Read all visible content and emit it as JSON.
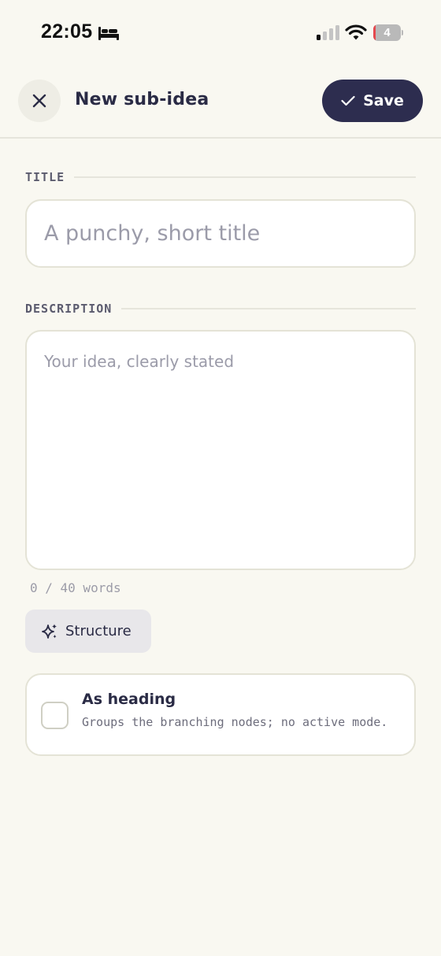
{
  "status_bar": {
    "time": "22:05",
    "battery_level": "4",
    "battery_fraction": 0.04,
    "icons": [
      "bed-icon",
      "cellular-signal-icon",
      "wifi-icon",
      "battery-icon"
    ]
  },
  "header": {
    "title": "New sub-idea",
    "close_icon": "close-icon",
    "save_label": "Save",
    "save_icon": "checkmark-icon"
  },
  "form": {
    "title_label": "TITLE",
    "title_value": "",
    "title_placeholder": "A punchy, short title",
    "description_label": "DESCRIPTION",
    "description_value": "",
    "description_placeholder": "Your idea, clearly stated",
    "word_count": "0 / 40 words",
    "structure_label": "Structure",
    "structure_icon": "sparkles-icon"
  },
  "heading_option": {
    "title": "As heading",
    "description": "Groups the branching nodes; no active mode.",
    "checked": false
  },
  "colors": {
    "background": "#f9f8f1",
    "accent": "#2d2d4f",
    "battery_low": "#e5484d"
  }
}
